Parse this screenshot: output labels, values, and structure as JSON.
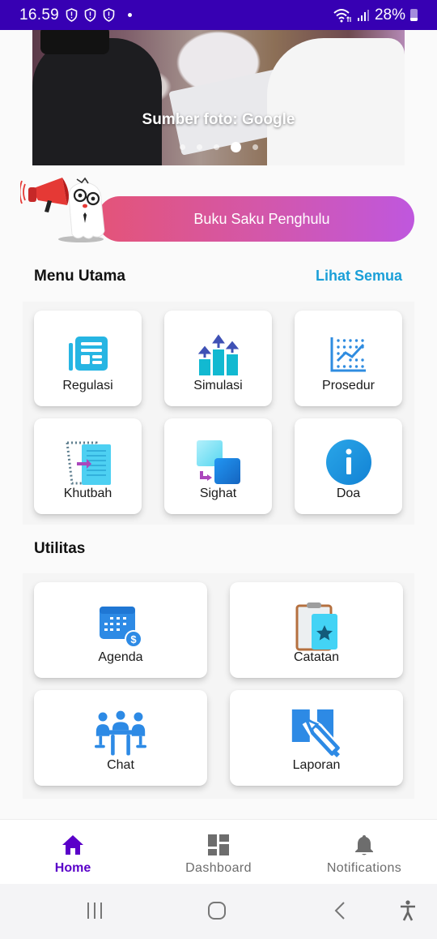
{
  "status_bar": {
    "time": "16.59",
    "notification_icons": [
      "shield-alert-icon",
      "shield-alert-icon",
      "shield-alert-icon"
    ],
    "battery_percent": "28%",
    "battery_level": 0.28
  },
  "banner": {
    "caption": "Sumber foto: Google",
    "slide_count": 5,
    "active_slide_index": 3
  },
  "promo": {
    "label": "Buku Saku Penghulu",
    "gradient_start": "#e45478",
    "gradient_end": "#bf57de"
  },
  "main_menu": {
    "title": "Menu Utama",
    "see_all_label": "Lihat Semua",
    "items": [
      {
        "label": "Regulasi",
        "icon": "newspaper-icon"
      },
      {
        "label": "Simulasi",
        "icon": "growth-bars-icon"
      },
      {
        "label": "Prosedur",
        "icon": "line-chart-icon"
      },
      {
        "label": "Khutbah",
        "icon": "document-import-icon"
      },
      {
        "label": "Sighat",
        "icon": "squares-transfer-icon"
      },
      {
        "label": "Doa",
        "icon": "info-circle-icon"
      }
    ]
  },
  "utilities": {
    "title": "Utilitas",
    "items": [
      {
        "label": "Agenda",
        "icon": "calendar-dollar-icon"
      },
      {
        "label": "Catatan",
        "icon": "clipboard-star-icon"
      },
      {
        "label": "Chat",
        "icon": "meeting-table-icon"
      },
      {
        "label": "Laporan",
        "icon": "report-pencil-icon"
      }
    ]
  },
  "bottom_nav": {
    "items": [
      {
        "label": "Home",
        "icon": "home-icon",
        "active": true
      },
      {
        "label": "Dashboard",
        "icon": "dashboard-icon",
        "active": false
      },
      {
        "label": "Notifications",
        "icon": "bell-icon",
        "active": false
      }
    ]
  },
  "colors": {
    "status_bar": "#3700b3",
    "accent_active": "#5a00c9",
    "link": "#1a9fd8",
    "icon_blue": "#1e88e5",
    "icon_cyan": "#26c6da"
  }
}
